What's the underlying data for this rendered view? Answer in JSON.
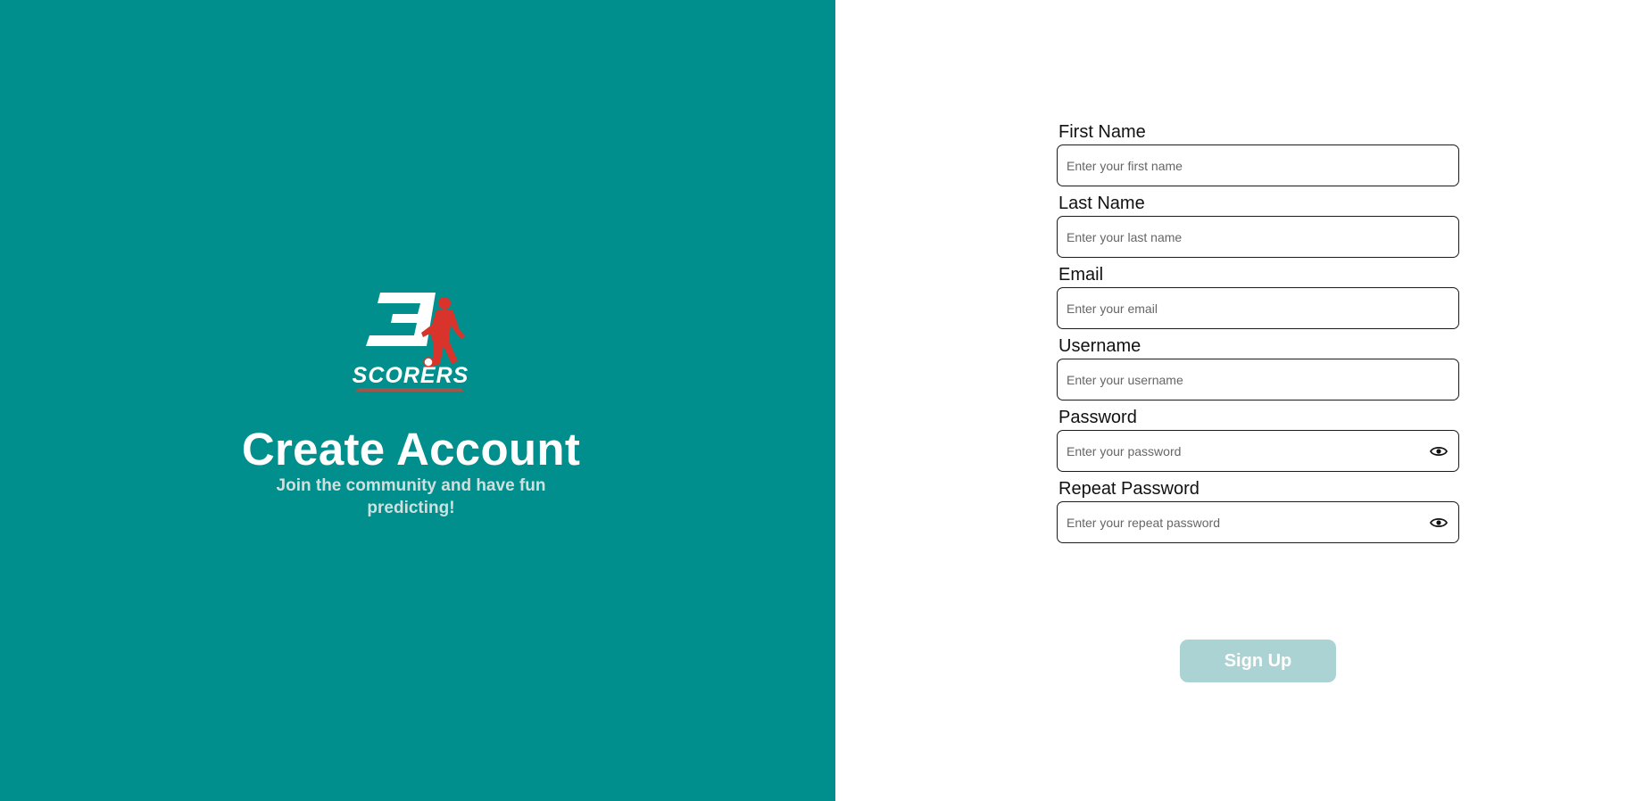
{
  "brand": {
    "logo_text": "SCORERS",
    "logo_numeral": "3",
    "title": "Create Account",
    "subtitle": "Join the community and have fun predicting!"
  },
  "form": {
    "fields": [
      {
        "label": "First Name",
        "placeholder": "Enter your first name",
        "value": ""
      },
      {
        "label": "Last Name",
        "placeholder": "Enter your last name",
        "value": ""
      },
      {
        "label": "Email",
        "placeholder": "Enter your email",
        "value": ""
      },
      {
        "label": "Username",
        "placeholder": "Enter your username",
        "value": ""
      },
      {
        "label": "Password",
        "placeholder": "Enter your password",
        "value": "",
        "icon": "eye-icon"
      },
      {
        "label": "Repeat Password",
        "placeholder": "Enter your repeat password",
        "value": "",
        "icon": "eye-icon"
      }
    ],
    "submit_label": "Sign Up"
  },
  "colors": {
    "panel_bg": "#008f8c",
    "button_bg": "#acd3d3",
    "logo_accent": "#d9342b"
  }
}
